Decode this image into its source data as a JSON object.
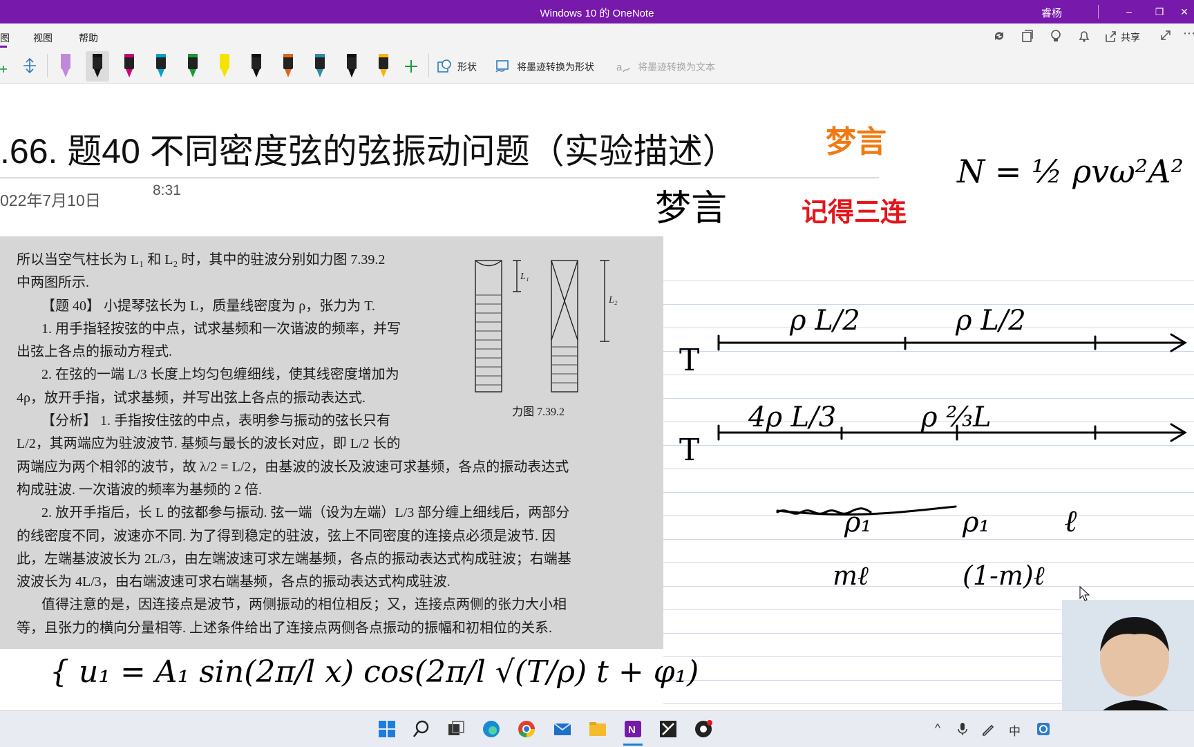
{
  "titlebar": {
    "title": "Windows 10 的 OneNote",
    "user": "睿杨",
    "minimize": "–",
    "restore": "❐",
    "close": "✕"
  },
  "menu": {
    "tabs": [
      "图",
      "视图",
      "帮助"
    ]
  },
  "menu_right_icons": [
    "sync-icon",
    "page-icon",
    "bulb-icon",
    "bell-icon"
  ],
  "share_label": "共享",
  "ribbon": {
    "shapes_label": "形状",
    "ink_to_shape_label": "将墨迹转换为形状",
    "ink_to_text_label": "将墨迹转换为文本",
    "add_pen": "+"
  },
  "pens": [
    {
      "color": "#c08ad8",
      "name": "purple-highlighter"
    },
    {
      "color": "#111111",
      "name": "black-pen",
      "selected": true
    },
    {
      "color": "#d1007a",
      "name": "magenta-pen"
    },
    {
      "color": "#00a5c8",
      "name": "cyan-pen"
    },
    {
      "color": "#1a9b3a",
      "name": "green-pen"
    },
    {
      "color": "#f5e400",
      "name": "yellow-highlighter"
    },
    {
      "color": "#111111",
      "name": "galaxy-pen"
    },
    {
      "color": "#e0651a",
      "name": "orange-pen"
    },
    {
      "color": "#2d8ea6",
      "name": "teal-pen"
    },
    {
      "color": "#111111",
      "name": "dark-pen"
    },
    {
      "color": "#f2b800",
      "name": "gold-pen"
    }
  ],
  "page": {
    "title": ".66.  题40 不同密度弦的弦振动问题（实验描述）",
    "date": "022年7月10日",
    "time": "8:31"
  },
  "scan": {
    "line1": "所以当空气柱长为 L₁ 和 L₂ 时，其中的驻波分别如力图 7.39.2",
    "line2": "中两图所示.",
    "line3": "【题 40】 小提琴弦长为 L，质量线密度为 ρ，张力为 T.",
    "line4": "1. 用手指轻按弦的中点，试求基频和一次谐波的频率，并写",
    "line5": "出弦上各点的振动方程式.",
    "line6": "2. 在弦的一端 L/3 长度上均匀包缠细线，使其线密度增加为",
    "line7": "4ρ，放开手指，试求基频，并写出弦上各点的振动表达式.",
    "line8": "【分析】 1. 手指按住弦的中点，表明参与振动的弦长只有",
    "line9": "L/2，其两端应为驻波波节. 基频与最长的波长对应，即 L/2 长的",
    "line10": "两端应为两个相邻的波节，故 λ/2 = L/2，由基波的波长及波速可求基频，各点的振动表达式",
    "line11": "构成驻波. 一次谐波的频率为基频的 2 倍.",
    "line12": "2. 放开手指后，长 L 的弦都参与振动. 弦一端（设为左端）L/3 部分缠上细线后，两部分",
    "line13": "的线密度不同，波速亦不同. 为了得到稳定的驻波，弦上不同密度的连接点必须是波节. 因",
    "line14": "此，左端基波波长为 2L/3，由左端波速可求左端基频，各点的振动表达式构成驻波；右端基",
    "line15": "波波长为 4L/3，由右端波速可求右端基频，各点的振动表达式构成驻波.",
    "line16": "值得注意的是，因连接点是波节，两侧振动的相位相反；又，连接点两侧的张力大小相",
    "line17": "等，且张力的横向分量相等. 上述条件给出了连接点两侧各点振动的振幅和初相位的关系.",
    "fig_caption": "力图 7.39.2",
    "fig_l1": "L₁",
    "fig_l2": "L₂"
  },
  "ink": {
    "orange_note": "梦言",
    "black_note": "梦言",
    "red_note": "记得三连",
    "formula": "N = ½ ρvω²A²",
    "row1_t": "T",
    "row1_left": "ρ L/2",
    "row1_right": "ρ L/2",
    "row2_t": "T",
    "row2_left": "4ρ L/3",
    "row2_right": "ρ ⅔L",
    "rho1_a": "ρ₁",
    "rho1_b": "ρ₁",
    "ell": "ℓ",
    "ml": "mℓ",
    "one_minus_ml": "(1-m)ℓ",
    "bottom_formula": "{ u₁ = A₁ sin(2π/l x) cos(2π/l √(T/ρ) t + φ₁)"
  },
  "colors": {
    "onenote_purple": "#7719AA",
    "orange_ink": "#f07a12",
    "red_ink": "#e3161b"
  },
  "taskbar": [
    "windows-start-icon",
    "search-icon",
    "task-view-icon",
    "edge-icon",
    "chrome-icon",
    "mail-icon",
    "file-explorer-icon",
    "onenote-icon",
    "app-icon",
    "app-icon-2"
  ],
  "tray": {
    "chevron": "^",
    "ime": "中"
  }
}
